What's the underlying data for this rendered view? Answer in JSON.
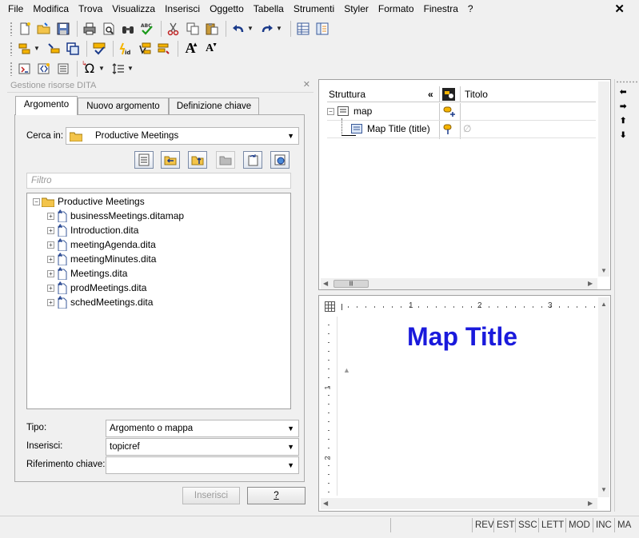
{
  "menu": [
    "File",
    "Modifica",
    "Trova",
    "Visualizza",
    "Inserisci",
    "Oggetto",
    "Tabella",
    "Strumenti",
    "Styler",
    "Formato",
    "Finestra",
    "?"
  ],
  "toolbar": {
    "row1": [
      "new-doc-icon",
      "open-folder-icon",
      "save-icon",
      "print-icon",
      "print-preview-icon",
      "find-icon",
      "spellcheck-icon",
      "cut-icon",
      "copy-icon",
      "paste-icon",
      "undo-icon",
      "redo-icon",
      "grid-view-icon",
      "split-view-icon"
    ],
    "row2": [
      "insert-element-icon",
      "insert-reference-icon",
      "wrap-element-icon",
      "check-icon",
      "set-id-icon",
      "attribute-icon",
      "style-icon",
      "font-bigger-icon",
      "font-smaller-icon"
    ],
    "row3": [
      "xref-icon",
      "insert-icon",
      "list-icon",
      "symbol-omega-icon",
      "sort-icon"
    ],
    "font_bigger_label": "A",
    "font_smaller_label": "A",
    "omega_label": "Ω"
  },
  "left_panel": {
    "title": "Gestione risorse DITA",
    "tabs": [
      "Argomento",
      "Nuovo argomento",
      "Definizione chiave"
    ],
    "active_tab": "Argomento",
    "search_label": "Cerca in:",
    "search_value": "Productive Meetings",
    "filter_placeholder": "Filtro",
    "tree": {
      "root": "Productive Meetings",
      "items": [
        "businessMeetings.ditamap",
        "Introduction.dita",
        "meetingAgenda.dita",
        "meetingMinutes.dita",
        "Meetings.dita",
        "prodMeetings.dita",
        "schedMeetings.dita"
      ]
    },
    "type_label": "Tipo:",
    "type_value": "Argomento o mappa",
    "insert_label": "Inserisci:",
    "insert_value": "topicref",
    "keyref_label": "Riferimento chiave:",
    "keyref_value": "",
    "insert_button": "Inserisci",
    "help_button": "?"
  },
  "structure_panel": {
    "col_structure": "Struttura",
    "collapse_symbol": "«",
    "col_title": "Titolo",
    "rows": [
      {
        "label": "map",
        "expander": "−"
      },
      {
        "label": "Map Title (title)",
        "title_value": "∅"
      }
    ]
  },
  "editor": {
    "map_title": "Map Title",
    "ruler_marks": [
      "1",
      "2",
      "3"
    ]
  },
  "status_bar": [
    "REV",
    "EST",
    "SSC",
    "LETT",
    "MOD",
    "INC",
    "MA"
  ],
  "colors": {
    "title_blue": "#1a1adc",
    "folder_yellow": "#f3c44a"
  }
}
